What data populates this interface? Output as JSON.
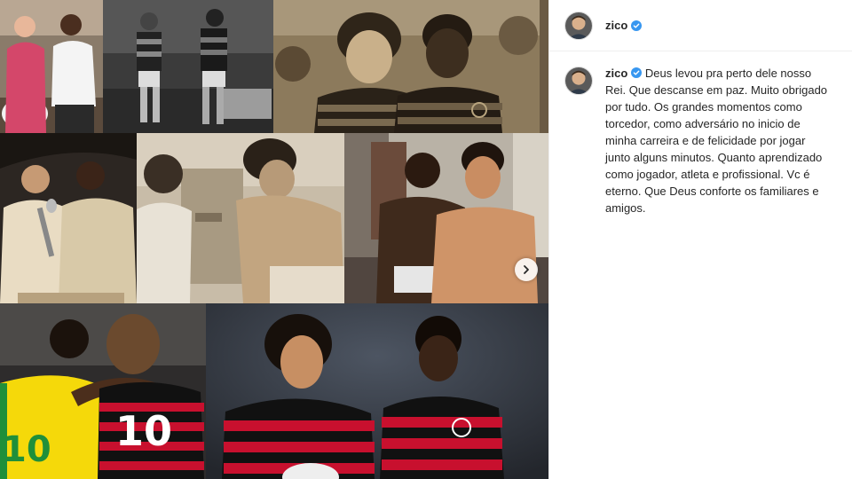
{
  "post": {
    "username": "zico",
    "verified": true,
    "caption": "Deus levou pra perto dele nosso Rei. Que descanse em paz. Muito obrigado por tudo. Os grandes momentos como torcedor, como adversário no inicio de minha carreira e de felicidade por jogar junto alguns minutos. Quanto aprendizado como jogador, atleta e profissional. Vc é eterno. Que Deus conforte os familiares e amigos."
  },
  "media": {
    "photo_count": 8,
    "jersey_numbers": [
      "10",
      "10"
    ],
    "next_icon": "chevron-right-icon"
  },
  "colors": {
    "verified_blue": "#3897f0",
    "flamengo_red": "#c8102e",
    "flamengo_black": "#111111",
    "brazil_yellow": "#f5d90a",
    "brazil_green": "#1f8f3a"
  }
}
